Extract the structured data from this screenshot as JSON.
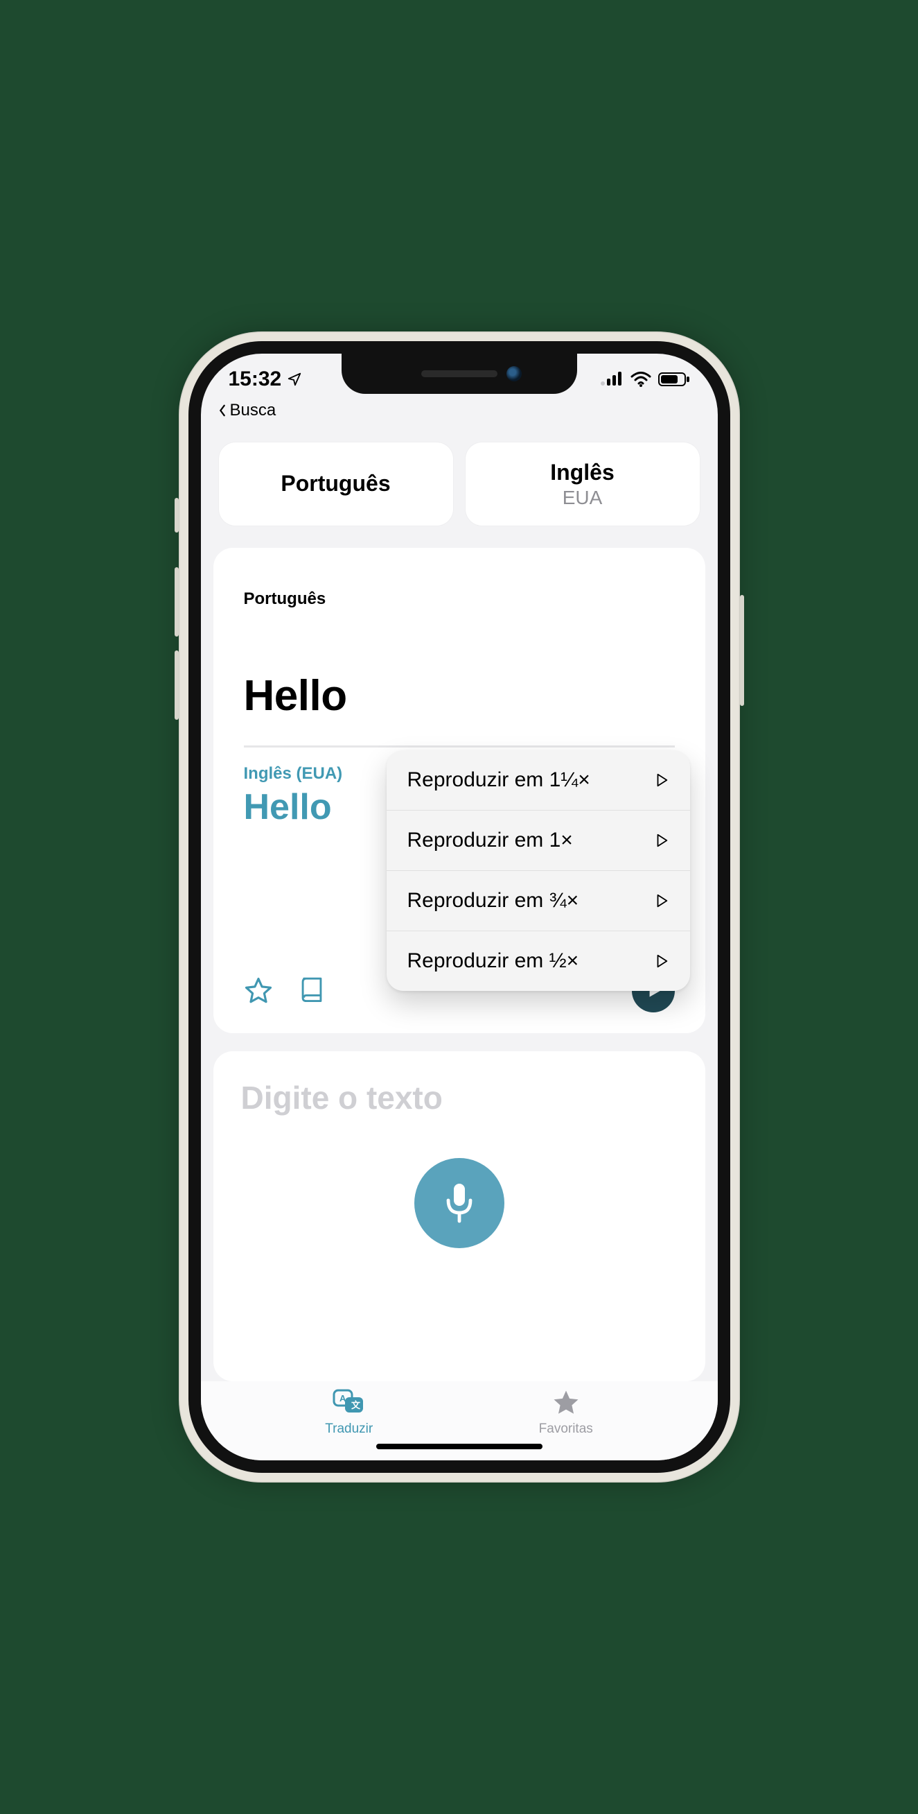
{
  "status": {
    "time": "15:32",
    "back_label": "Busca"
  },
  "languages": {
    "left": {
      "primary": "Português",
      "secondary": ""
    },
    "right": {
      "primary": "Inglês",
      "secondary": "EUA"
    }
  },
  "card": {
    "source_label": "Português",
    "source_text": "Hello",
    "target_label": "Inglês (EUA)",
    "target_text": "Hello"
  },
  "speed_menu": {
    "items": [
      {
        "label": "Reproduzir em 1¼×"
      },
      {
        "label": "Reproduzir em 1×"
      },
      {
        "label": "Reproduzir em ¾×"
      },
      {
        "label": "Reproduzir em ½×"
      }
    ]
  },
  "input": {
    "placeholder": "Digite o texto"
  },
  "tabs": {
    "translate": "Traduzir",
    "favorites": "Favoritas"
  },
  "colors": {
    "accent": "#4097b1",
    "play_bg": "#214a56"
  }
}
